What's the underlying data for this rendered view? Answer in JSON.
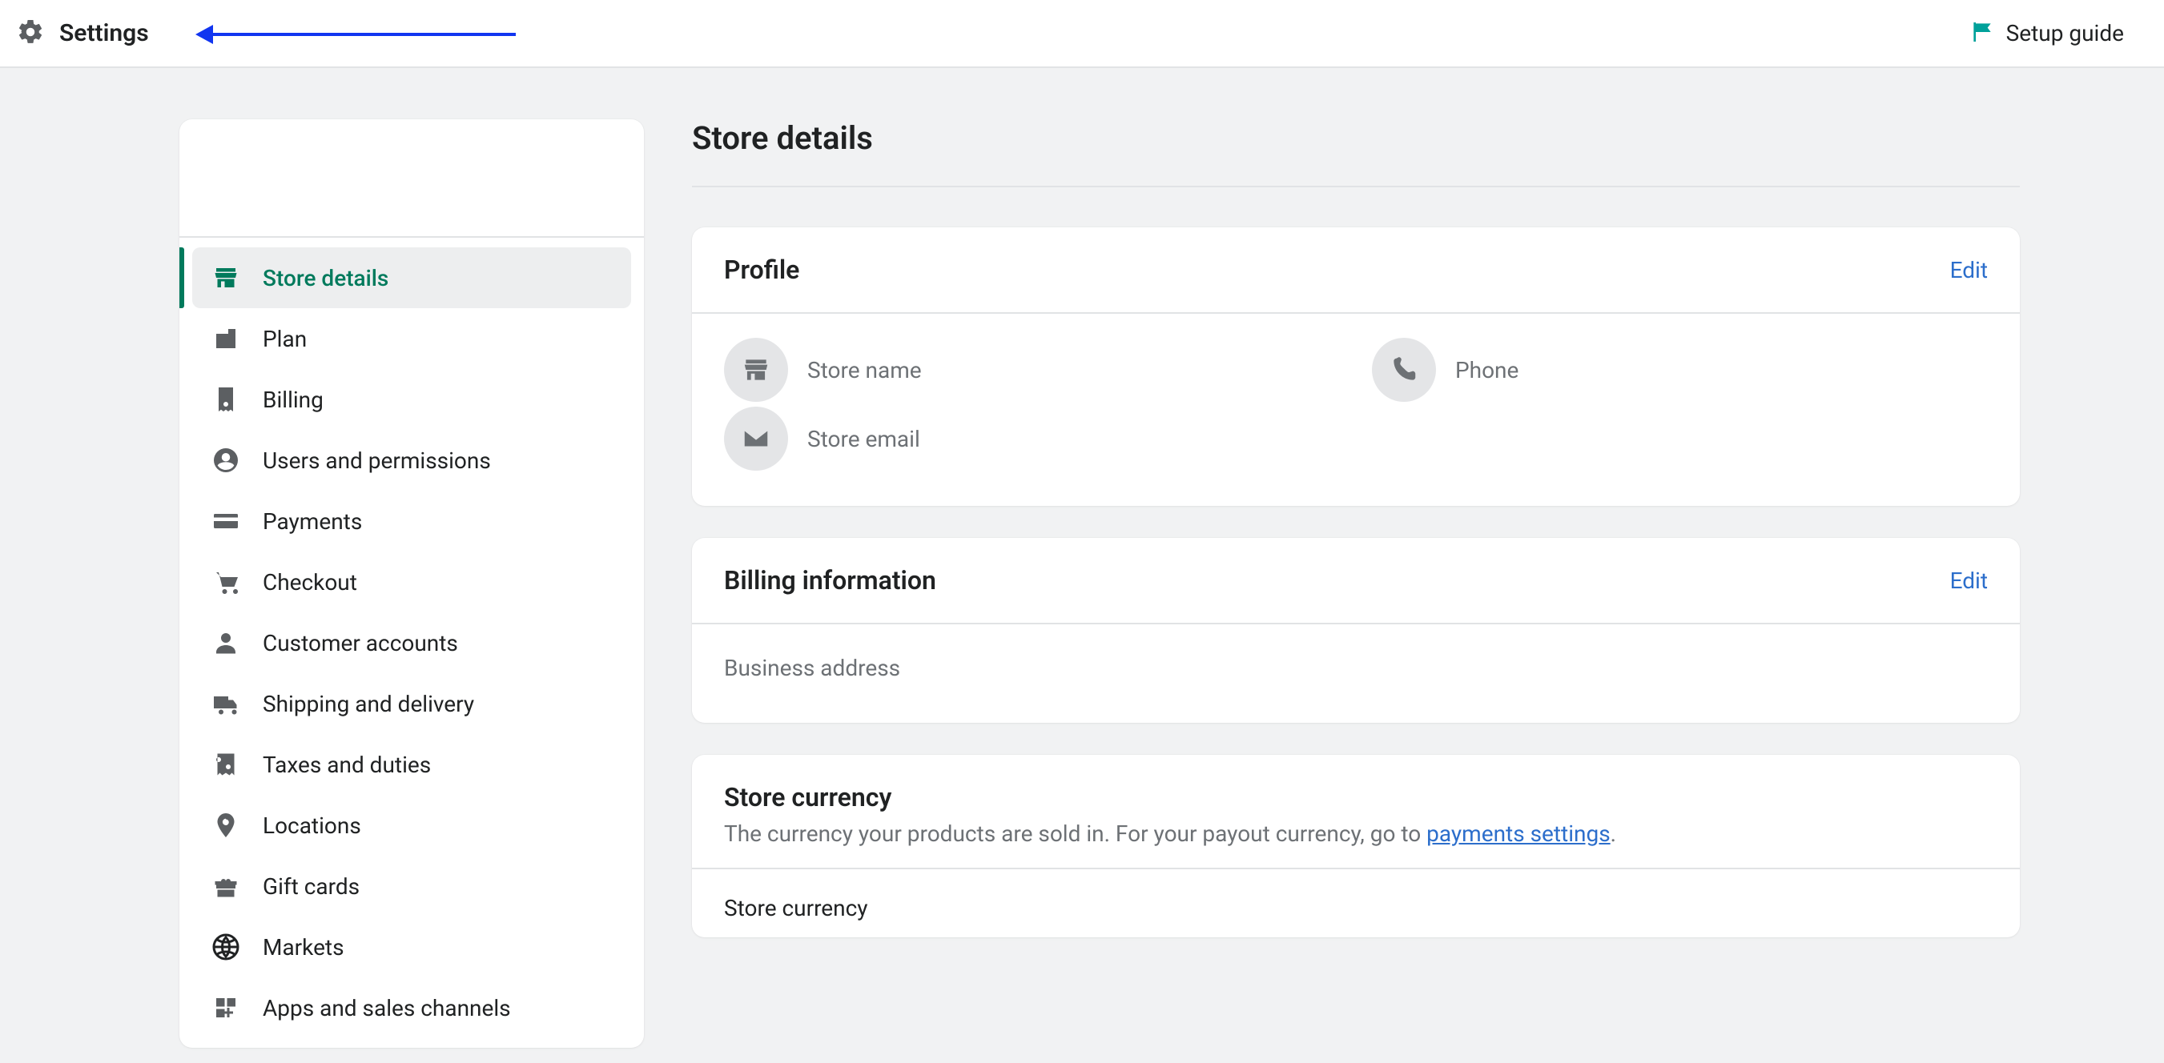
{
  "topbar": {
    "title": "Settings",
    "setup_guide": "Setup guide"
  },
  "sidebar": {
    "items": [
      {
        "id": "store-details",
        "label": "Store details",
        "icon": "store",
        "active": true
      },
      {
        "id": "plan",
        "label": "Plan",
        "icon": "plan",
        "active": false
      },
      {
        "id": "billing",
        "label": "Billing",
        "icon": "receipt",
        "active": false
      },
      {
        "id": "users",
        "label": "Users and permissions",
        "icon": "user-circle",
        "active": false
      },
      {
        "id": "payments",
        "label": "Payments",
        "icon": "card",
        "active": false
      },
      {
        "id": "checkout",
        "label": "Checkout",
        "icon": "cart",
        "active": false
      },
      {
        "id": "customer-accounts",
        "label": "Customer accounts",
        "icon": "person",
        "active": false
      },
      {
        "id": "shipping",
        "label": "Shipping and delivery",
        "icon": "truck",
        "active": false
      },
      {
        "id": "taxes",
        "label": "Taxes and duties",
        "icon": "percent",
        "active": false
      },
      {
        "id": "locations",
        "label": "Locations",
        "icon": "pin",
        "active": false
      },
      {
        "id": "gift-cards",
        "label": "Gift cards",
        "icon": "gift",
        "active": false
      },
      {
        "id": "markets",
        "label": "Markets",
        "icon": "globe",
        "active": false
      },
      {
        "id": "apps",
        "label": "Apps and sales channels",
        "icon": "apps",
        "active": false
      }
    ]
  },
  "main": {
    "title": "Store details",
    "profile": {
      "title": "Profile",
      "edit": "Edit",
      "store_name": "Store name",
      "store_email": "Store email",
      "phone": "Phone"
    },
    "billing": {
      "title": "Billing information",
      "edit": "Edit",
      "business_address": "Business address"
    },
    "currency": {
      "title": "Store currency",
      "desc_prefix": "The currency your products are sold in. For your payout currency, go to ",
      "link": "payments settings",
      "desc_suffix": ".",
      "label": "Store currency"
    }
  }
}
